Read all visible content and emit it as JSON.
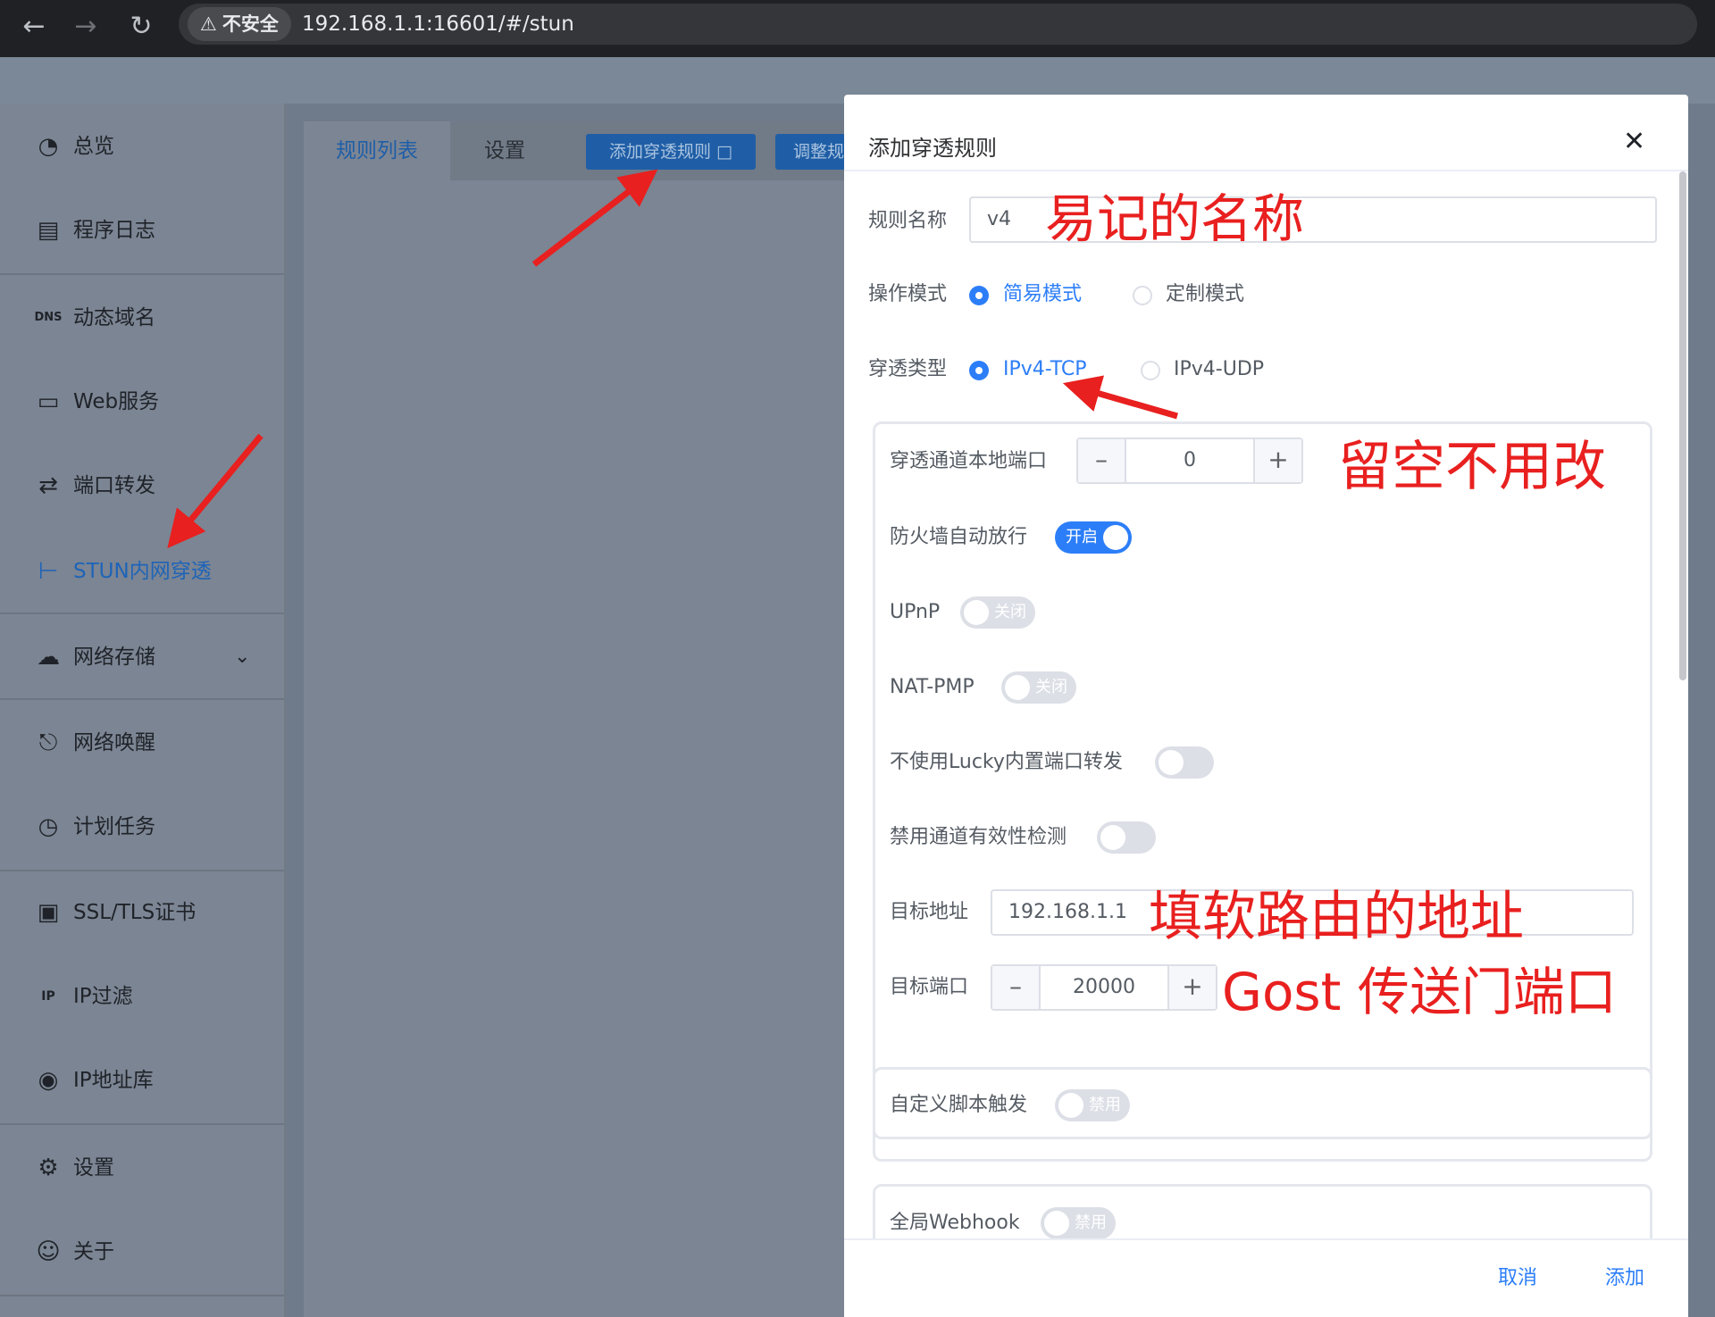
{
  "browser": {
    "back_icon": "arrow-left-icon",
    "forward_icon": "arrow-right-icon",
    "reload_icon": "reload-icon",
    "security_label": "不安全",
    "url": "192.168.1.1:16601/#/stun"
  },
  "sidebar": {
    "items": [
      {
        "label": "总览",
        "icon": "dashboard-icon"
      },
      {
        "label": "程序日志",
        "icon": "log-icon"
      },
      {
        "label": "动态域名",
        "icon": "dns-icon"
      },
      {
        "label": "Web服务",
        "icon": "web-service-icon"
      },
      {
        "label": "端口转发",
        "icon": "port-forward-icon"
      },
      {
        "label": "STUN内网穿透",
        "icon": "stun-icon",
        "active": true
      },
      {
        "label": "网络存储",
        "icon": "cloud-storage-icon",
        "has_submenu": true
      },
      {
        "label": "网络唤醒",
        "icon": "bell-icon"
      },
      {
        "label": "计划任务",
        "icon": "clock-icon"
      },
      {
        "label": "SSL/TLS证书",
        "icon": "certificate-icon"
      },
      {
        "label": "IP过滤",
        "icon": "ip-filter-icon"
      },
      {
        "label": "IP地址库",
        "icon": "ip-database-icon"
      },
      {
        "label": "设置",
        "icon": "gear-icon"
      },
      {
        "label": "关于",
        "icon": "about-icon"
      }
    ]
  },
  "main": {
    "tabs": [
      {
        "label": "规则列表",
        "active": true
      },
      {
        "label": "设置"
      }
    ],
    "add_rule_button": "添加穿透规则",
    "adjust_button": "调整规"
  },
  "dialog": {
    "title": "添加穿透规则",
    "rule_name": {
      "label": "规则名称",
      "value": "v4"
    },
    "mode": {
      "label": "操作模式",
      "options": [
        {
          "label": "简易模式",
          "selected": true
        },
        {
          "label": "定制模式",
          "selected": false
        }
      ]
    },
    "type": {
      "label": "穿透类型",
      "options": [
        {
          "label": "IPv4-TCP",
          "selected": true
        },
        {
          "label": "IPv4-UDP",
          "selected": false
        }
      ]
    },
    "local_port": {
      "label": "穿透通道本地端口",
      "value": "0"
    },
    "firewall": {
      "label": "防火墙自动放行",
      "state": "开启",
      "on": true
    },
    "upnp": {
      "label": "UPnP",
      "state": "关闭",
      "on": false
    },
    "nat_pmp": {
      "label": "NAT-PMP",
      "state": "关闭",
      "on": false
    },
    "no_builtin_forward": {
      "label": "不使用Lucky内置端口转发",
      "on": false
    },
    "disable_check": {
      "label": "禁用通道有效性检测",
      "on": false
    },
    "target_address": {
      "label": "目标地址",
      "value": "192.168.1.1"
    },
    "target_port": {
      "label": "目标端口",
      "value": "20000"
    },
    "custom_script": {
      "label": "自定义脚本触发",
      "state": "禁用",
      "on": false
    },
    "global_webhook": {
      "label": "全局Webhook",
      "state": "禁用",
      "on": false
    },
    "cancel_button": "取消",
    "confirm_button": "添加"
  },
  "annotations": {
    "name_note": "易记的名称",
    "port_note": "留空不用改",
    "address_note": "填软路由的地址",
    "target_port_note": "Gost 传送门端口",
    "color": "#e8201f"
  },
  "colors": {
    "primary": "#2c7ef8",
    "overlay": "#7c8593",
    "browser_bar": "#202124"
  }
}
